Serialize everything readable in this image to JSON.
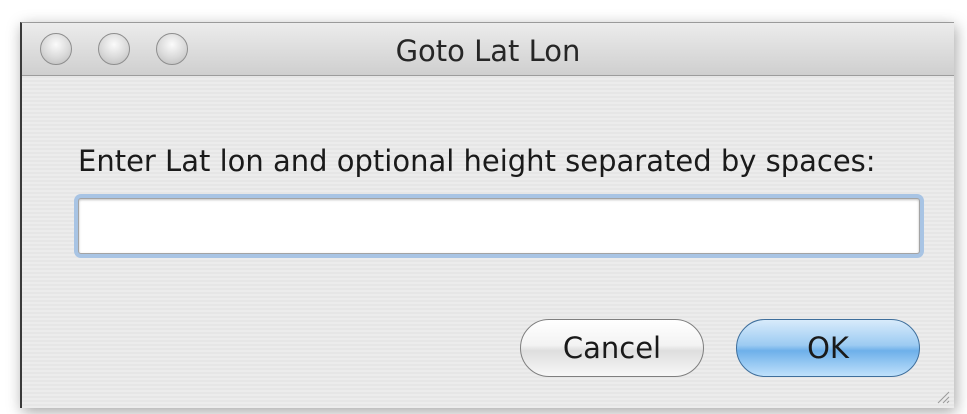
{
  "window": {
    "title": "Goto Lat Lon"
  },
  "dialog": {
    "prompt": "Enter Lat lon and optional height separated by spaces:",
    "input_value": "",
    "cancel_label": "Cancel",
    "ok_label": "OK"
  },
  "icons": {
    "close": "close-button-icon",
    "minimize": "minimize-button-icon",
    "zoom": "zoom-button-icon",
    "resize": "resize-grip-icon"
  },
  "colors": {
    "default_button": "#6eb0ea",
    "focus_ring": "#a8c4e4"
  }
}
